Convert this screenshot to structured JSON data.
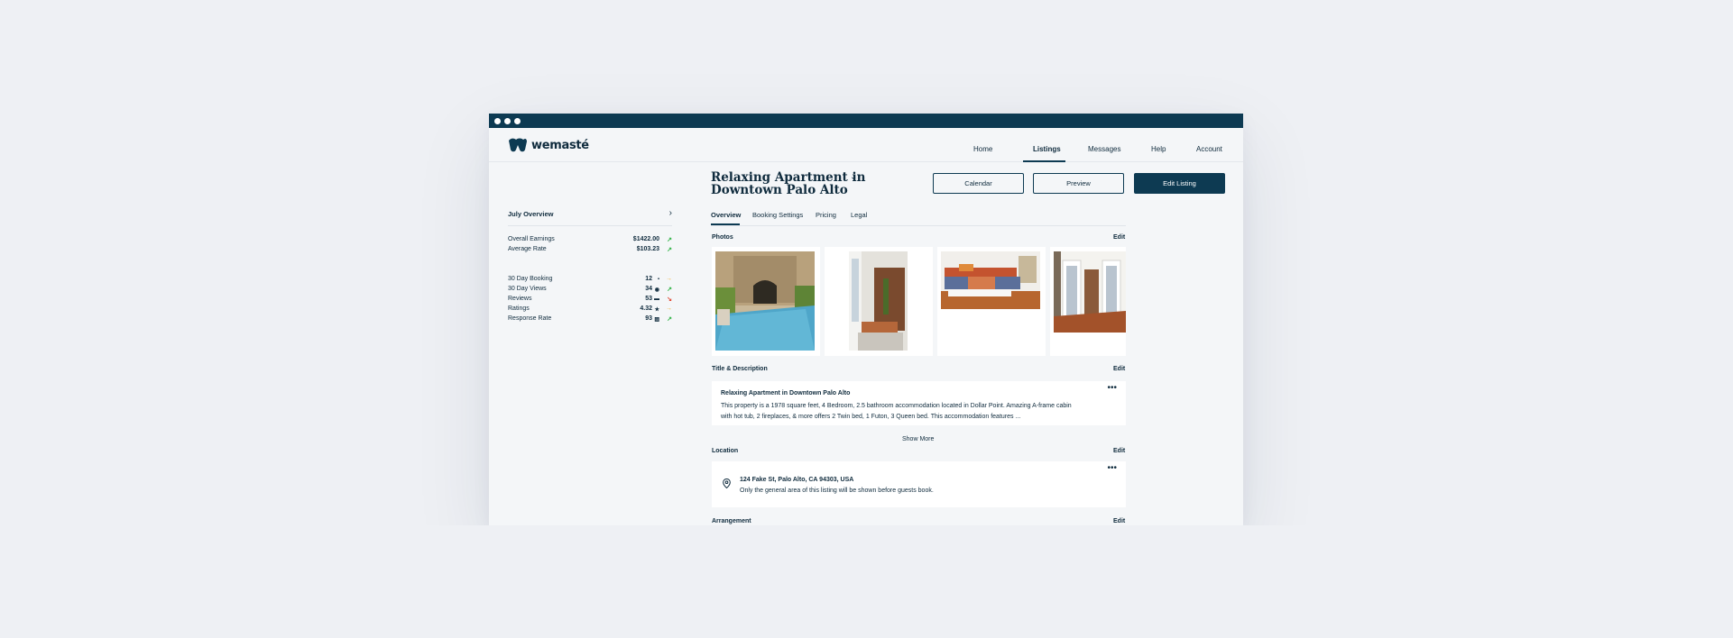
{
  "brand": {
    "name": "wemasté"
  },
  "nav": {
    "items": [
      {
        "label": "Home"
      },
      {
        "label": "Listings"
      },
      {
        "label": "Messages"
      },
      {
        "label": "Help"
      },
      {
        "label": "Account"
      }
    ]
  },
  "overview": {
    "title": "July Overview",
    "earnings": [
      {
        "label": "Overall Earnings",
        "value": "$1422.00",
        "trend": "up"
      },
      {
        "label": "Average Rate",
        "value": "$103.23",
        "trend": "up"
      }
    ],
    "metrics": [
      {
        "label": "30 Day Booking",
        "value": "12",
        "icon": "calendar-icon",
        "trend": "flat"
      },
      {
        "label": "30 Day Views",
        "value": "34",
        "icon": "eye-icon",
        "trend": "up"
      },
      {
        "label": "Reviews",
        "value": "53",
        "icon": "comment-icon",
        "trend": "down"
      },
      {
        "label": "Ratings",
        "value": "4.32",
        "icon": "star-icon",
        "trend": "flat"
      },
      {
        "label": "Response Rate",
        "value": "93",
        "icon": "percent-icon",
        "trend": "up"
      }
    ]
  },
  "listing": {
    "title": "Relaxing Apartment in Downtown Palo Alto",
    "buttons": {
      "calendar": "Calendar",
      "preview": "Preview",
      "edit": "Edit Listing"
    },
    "tabs": [
      {
        "label": "Overview"
      },
      {
        "label": "Booking Settings"
      },
      {
        "label": "Pricing"
      },
      {
        "label": "Legal"
      }
    ]
  },
  "sections": {
    "photos": {
      "label": "Photos",
      "edit": "Edit"
    },
    "title_desc": {
      "label": "Title & Description",
      "edit": "Edit",
      "heading": "Relaxing Apartment in Downtown Palo Alto",
      "body": "This property is a 1978 square feet, 4 Bedroom, 2.5 bathroom accommodation located in Dollar Point. Amazing A-frame cabin with hot tub, 2 fireplaces, & more offers 2 Twin bed, 1 Futon, 3 Queen bed. This accommodation features ...",
      "show_more": "Show More"
    },
    "location": {
      "label": "Location",
      "edit": "Edit",
      "address": "124 Fake St, Palo Alto, CA 94303, USA",
      "note": "Only the general area of this listing will be shown before guests book."
    },
    "arrangement": {
      "label": "Arrangement",
      "edit": "Edit"
    }
  },
  "colors": {
    "primary": "#0d3a52",
    "up": "#2fb344",
    "down": "#e0452f",
    "flat": "#f2b233"
  }
}
